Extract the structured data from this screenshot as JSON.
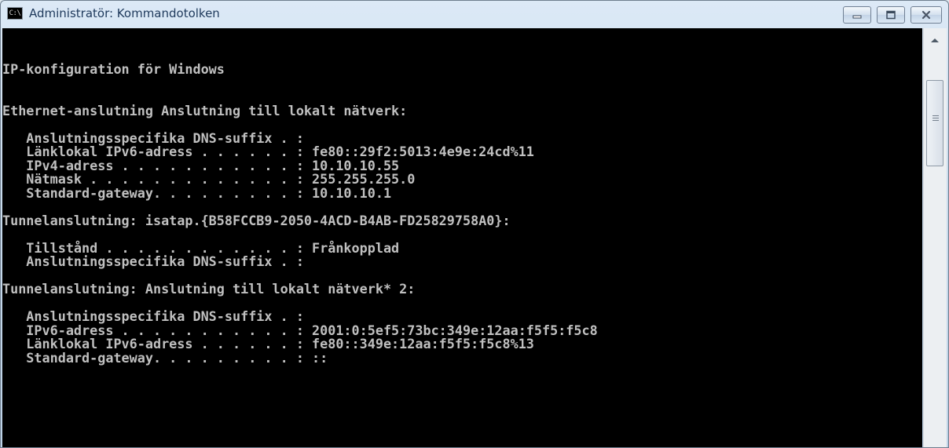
{
  "window": {
    "title": "Administratör: Kommandotolken",
    "icon_text": "C:\\"
  },
  "controls": {
    "minimize": "minimize-icon",
    "maximize": "maximize-icon",
    "close": "close-icon"
  },
  "console": {
    "lines": [
      "",
      "IP-konfiguration för Windows",
      "",
      "",
      "Ethernet-anslutning Anslutning till lokalt nätverk:",
      "",
      "   Anslutningsspecifika DNS-suffix . :",
      "   Länklokal IPv6-adress . . . . . . : fe80::29f2:5013:4e9e:24cd%11",
      "   IPv4-adress . . . . . . . . . . . : 10.10.10.55",
      "   Nätmask . . . . . . . . . . . . . : 255.255.255.0",
      "   Standard-gateway. . . . . . . . . : 10.10.10.1",
      "",
      "Tunnelanslutning: isatap.{B58FCCB9-2050-4ACD-B4AB-FD25829758A0}:",
      "",
      "   Tillstånd . . . . . . . . . . . . : Frånkopplad",
      "   Anslutningsspecifika DNS-suffix . :",
      "",
      "Tunnelanslutning: Anslutning till lokalt nätverk* 2:",
      "",
      "   Anslutningsspecifika DNS-suffix . :",
      "   IPv6-adress . . . . . . . . . . . : 2001:0:5ef5:73bc:349e:12aa:f5f5:f5c8",
      "   Länklokal IPv6-adress . . . . . . : fe80::349e:12aa:f5f5:f5c8%13",
      "   Standard-gateway. . . . . . . . . : ::"
    ]
  }
}
